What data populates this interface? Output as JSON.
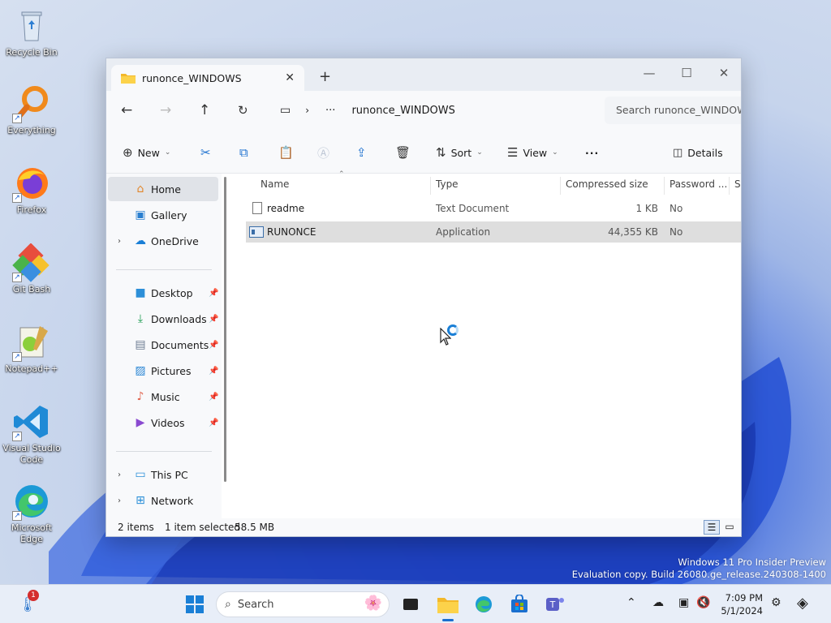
{
  "desktop": {
    "icons": [
      {
        "label": "Recycle Bin",
        "icon": "recycle-bin-icon"
      },
      {
        "label": "Everything",
        "icon": "everything-search-icon"
      },
      {
        "label": "Firefox",
        "icon": "firefox-icon"
      },
      {
        "label": "Git Bash",
        "icon": "git-bash-icon"
      },
      {
        "label": "Notepad++",
        "icon": "notepad-plus-plus-icon"
      },
      {
        "label": "Visual Studio Code",
        "icon": "vscode-icon"
      },
      {
        "label": "Microsoft Edge",
        "icon": "edge-icon"
      }
    ],
    "watermark_line1": "Windows 11 Pro Insider Preview",
    "watermark_line2": "Evaluation copy. Build 26080.ge_release.240308-1400"
  },
  "explorer": {
    "tab_title": "runonce_WINDOWS",
    "address_path": "runonce_WINDOWS",
    "address_more": "···",
    "search_placeholder": "Search runonce_WINDOWS",
    "toolbar": {
      "new_label": "New",
      "sort_label": "Sort",
      "view_label": "View",
      "more_label": "···",
      "details_label": "Details"
    },
    "sidebar": {
      "home": "Home",
      "gallery": "Gallery",
      "onedrive": "OneDrive",
      "desktop": "Desktop",
      "downloads": "Downloads",
      "documents": "Documents",
      "pictures": "Pictures",
      "music": "Music",
      "videos": "Videos",
      "thispc": "This PC",
      "network": "Network"
    },
    "columns": {
      "name": "Name",
      "type": "Type",
      "compressed_size": "Compressed size",
      "password": "Password ...",
      "size": "Si"
    },
    "files": [
      {
        "name": "readme",
        "type": "Text Document",
        "compressed_size": "1 KB",
        "password": "No"
      },
      {
        "name": "RUNONCE",
        "type": "Application",
        "compressed_size": "44,355 KB",
        "password": "No"
      }
    ],
    "status": {
      "count": "2 items",
      "selected": "1 item selected",
      "size": "58.5 MB"
    }
  },
  "taskbar": {
    "search_label": "Search",
    "time": "7:09 PM",
    "date": "5/1/2024",
    "notification_count": "1"
  },
  "colors": {
    "accent": "#1a6fcf",
    "selection": "#dedede"
  }
}
